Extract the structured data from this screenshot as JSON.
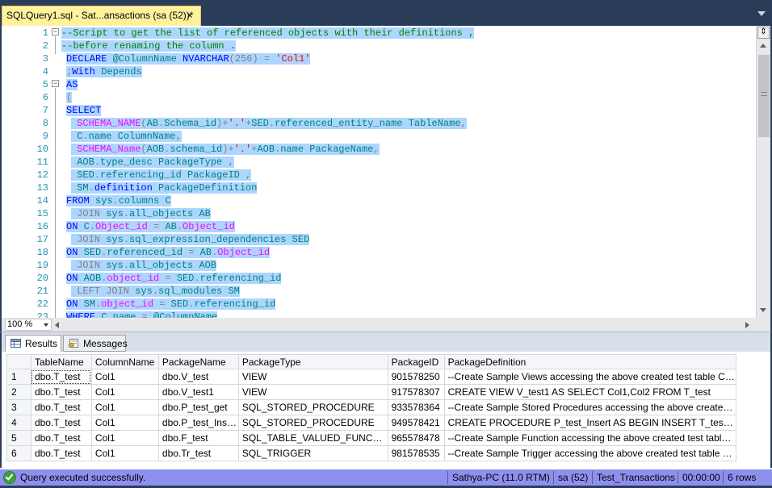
{
  "window": {
    "tab_title": "SQLQuery1.sql - Sat...ansactions (sa (52))*",
    "tab_close_glyph": "×"
  },
  "editor": {
    "line_numbers": [
      "1",
      "2",
      "3",
      "4",
      "5",
      "6",
      "7",
      "8",
      "9",
      "10",
      "11",
      "12",
      "13",
      "14",
      "15",
      "16",
      "17",
      "18",
      "19",
      "20",
      "21",
      "22",
      "23"
    ],
    "lines": [
      [
        {
          "t": "--Script to get the list of referenced objects with their definitions ,",
          "c": "cm"
        }
      ],
      [
        {
          "t": "--before renaming the column .",
          "c": "cm"
        }
      ],
      [
        {
          "t": "DECLARE ",
          "c": "kw"
        },
        {
          "t": "@ColumnName ",
          "c": "id"
        },
        {
          "t": "NVARCHAR",
          "c": "kw"
        },
        {
          "t": "(256) ",
          "c": "gr"
        },
        {
          "t": "= ",
          "c": "gr"
        },
        {
          "t": "'Col1'",
          "c": "st"
        }
      ],
      [
        {
          "t": ";",
          "c": "gr"
        },
        {
          "t": "With ",
          "c": "kw"
        },
        {
          "t": "Depends",
          "c": "id"
        }
      ],
      [
        {
          "t": "AS",
          "c": "kw"
        }
      ],
      [
        {
          "t": "(",
          "c": "gr"
        }
      ],
      [
        {
          "t": "SELECT",
          "c": "kw"
        }
      ],
      [
        {
          "t": " SCHEMA_NAME",
          "c": "fn"
        },
        {
          "t": "(",
          "c": "gr"
        },
        {
          "t": "AB",
          "c": "id"
        },
        {
          "t": ".",
          "c": "gr"
        },
        {
          "t": "Schema_id",
          "c": "id"
        },
        {
          "t": ")+",
          "c": "gr"
        },
        {
          "t": "'.'",
          "c": "st"
        },
        {
          "t": "+",
          "c": "gr"
        },
        {
          "t": "SED",
          "c": "id"
        },
        {
          "t": ".",
          "c": "gr"
        },
        {
          "t": "referenced_entity_name TableName",
          "c": "id"
        },
        {
          "t": ",",
          "c": "gr"
        }
      ],
      [
        {
          "t": " C",
          "c": "id"
        },
        {
          "t": ".",
          "c": "gr"
        },
        {
          "t": "name ColumnName",
          "c": "id"
        },
        {
          "t": ",",
          "c": "gr"
        }
      ],
      [
        {
          "t": " SCHEMA_Name",
          "c": "fn"
        },
        {
          "t": "(",
          "c": "gr"
        },
        {
          "t": "AOB",
          "c": "id"
        },
        {
          "t": ".",
          "c": "gr"
        },
        {
          "t": "schema_id",
          "c": "id"
        },
        {
          "t": ")+",
          "c": "gr"
        },
        {
          "t": "'.'",
          "c": "st"
        },
        {
          "t": "+",
          "c": "gr"
        },
        {
          "t": "AOB",
          "c": "id"
        },
        {
          "t": ".",
          "c": "gr"
        },
        {
          "t": "name PackageName",
          "c": "id"
        },
        {
          "t": ",",
          "c": "gr"
        }
      ],
      [
        {
          "t": " AOB",
          "c": "id"
        },
        {
          "t": ".",
          "c": "gr"
        },
        {
          "t": "type_desc PackageType ",
          "c": "id"
        },
        {
          "t": ",",
          "c": "gr"
        }
      ],
      [
        {
          "t": " SED",
          "c": "id"
        },
        {
          "t": ".",
          "c": "gr"
        },
        {
          "t": "referencing_id PackageID ",
          "c": "id"
        },
        {
          "t": ",",
          "c": "gr"
        }
      ],
      [
        {
          "t": " SM",
          "c": "id"
        },
        {
          "t": ".",
          "c": "gr"
        },
        {
          "t": "definition ",
          "c": "kw"
        },
        {
          "t": "PackageDefinition",
          "c": "id"
        }
      ],
      [
        {
          "t": "FROM ",
          "c": "kw"
        },
        {
          "t": "sys",
          "c": "id"
        },
        {
          "t": ".",
          "c": "gr"
        },
        {
          "t": "columns C",
          "c": "id"
        }
      ],
      [
        {
          "t": " JOIN ",
          "c": "gr"
        },
        {
          "t": "sys",
          "c": "id"
        },
        {
          "t": ".",
          "c": "gr"
        },
        {
          "t": "all_objects",
          "c": "id"
        },
        {
          "t": " AB",
          "c": "id"
        }
      ],
      [
        {
          "t": "ON ",
          "c": "kw"
        },
        {
          "t": "C",
          "c": "id"
        },
        {
          "t": ".",
          "c": "gr"
        },
        {
          "t": "Object_id ",
          "c": "fn"
        },
        {
          "t": "= ",
          "c": "gr"
        },
        {
          "t": "AB",
          "c": "id"
        },
        {
          "t": ".",
          "c": "gr"
        },
        {
          "t": "Object_id",
          "c": "fn"
        }
      ],
      [
        {
          "t": " JOIN ",
          "c": "gr"
        },
        {
          "t": "sys",
          "c": "id"
        },
        {
          "t": ".",
          "c": "gr"
        },
        {
          "t": "sql_expression_dependencies SED",
          "c": "id"
        }
      ],
      [
        {
          "t": "ON ",
          "c": "kw"
        },
        {
          "t": "SED",
          "c": "id"
        },
        {
          "t": ".",
          "c": "gr"
        },
        {
          "t": "referenced_id ",
          "c": "id"
        },
        {
          "t": "= ",
          "c": "gr"
        },
        {
          "t": "AB",
          "c": "id"
        },
        {
          "t": ".",
          "c": "gr"
        },
        {
          "t": "Object_id",
          "c": "fn"
        }
      ],
      [
        {
          "t": " JOIN ",
          "c": "gr"
        },
        {
          "t": "sys",
          "c": "id"
        },
        {
          "t": ".",
          "c": "gr"
        },
        {
          "t": "all_objects",
          "c": "id"
        },
        {
          "t": " AOB",
          "c": "id"
        }
      ],
      [
        {
          "t": "ON ",
          "c": "kw"
        },
        {
          "t": "AOB",
          "c": "id"
        },
        {
          "t": ".",
          "c": "gr"
        },
        {
          "t": "object_id ",
          "c": "fn"
        },
        {
          "t": "= ",
          "c": "gr"
        },
        {
          "t": "SED",
          "c": "id"
        },
        {
          "t": ".",
          "c": "gr"
        },
        {
          "t": "referencing_id",
          "c": "id"
        }
      ],
      [
        {
          "t": " LEFT JOIN ",
          "c": "gr"
        },
        {
          "t": "sys",
          "c": "id"
        },
        {
          "t": ".",
          "c": "gr"
        },
        {
          "t": "sql_modules SM",
          "c": "id"
        }
      ],
      [
        {
          "t": "ON ",
          "c": "kw"
        },
        {
          "t": "SM",
          "c": "id"
        },
        {
          "t": ".",
          "c": "gr"
        },
        {
          "t": "object_id ",
          "c": "fn"
        },
        {
          "t": "= ",
          "c": "gr"
        },
        {
          "t": "SED",
          "c": "id"
        },
        {
          "t": ".",
          "c": "gr"
        },
        {
          "t": "referencing_id",
          "c": "id"
        }
      ],
      [
        {
          "t": "WHERE ",
          "c": "kw"
        },
        {
          "t": "C",
          "c": "id"
        },
        {
          "t": ".",
          "c": "gr"
        },
        {
          "t": "name ",
          "c": "id"
        },
        {
          "t": "= ",
          "c": "gr"
        },
        {
          "t": "@ColumnName",
          "c": "id"
        }
      ]
    ],
    "fold_markers": [
      "−",
      "−"
    ],
    "split_glyph": "⇕"
  },
  "zoom": {
    "value": "100 %"
  },
  "results_tabs": {
    "results": "Results",
    "messages": "Messages"
  },
  "grid": {
    "columns": [
      "",
      "TableName",
      "ColumnName",
      "PackageName",
      "PackageType",
      "PackageID",
      "PackageDefinition"
    ],
    "rows": [
      [
        "1",
        "dbo.T_test",
        "Col1",
        "dbo.V_test",
        "VIEW",
        "901578250",
        "--Create Sample Views accessing the above created test table   CREA..."
      ],
      [
        "2",
        "dbo.T_test",
        "Col1",
        "dbo.V_test1",
        "VIEW",
        "917578307",
        "CREATE VIEW V_test1   AS   SELECT Col1,Col2 FROM T_test"
      ],
      [
        "3",
        "dbo.T_test",
        "Col1",
        "dbo.P_test_get",
        "SQL_STORED_PROCEDURE",
        "933578364",
        "--Create Sample Stored Procedures accessing the above created test ..."
      ],
      [
        "4",
        "dbo.T_test",
        "Col1",
        "dbo.P_test_Insert",
        "SQL_STORED_PROCEDURE",
        "949578421",
        "CREATE PROCEDURE P_test_Insert   AS   BEGIN   INSERT T_test ..."
      ],
      [
        "5",
        "dbo.T_test",
        "Col1",
        "dbo.F_test",
        "SQL_TABLE_VALUED_FUNCTION",
        "965578478",
        "--Create Sample Function accessing the above created test table   CR..."
      ],
      [
        "6",
        "dbo.T_test",
        "Col1",
        "dbo.Tr_test",
        "SQL_TRIGGER",
        "981578535",
        "--Create Sample Trigger accessing the above created test table   CRE..."
      ]
    ]
  },
  "status": {
    "message": "Query executed successfully.",
    "server": "Sathya-PC (11.0 RTM)",
    "user": "sa (52)",
    "database": "Test_Transactions",
    "elapsed": "00:00:00",
    "rows": "6 rows"
  },
  "colors": {
    "tab_active": "#FFF29D",
    "chrome": "#2B3C59",
    "selection": "#ADD6FF",
    "statusbar": "#8E90EE"
  }
}
